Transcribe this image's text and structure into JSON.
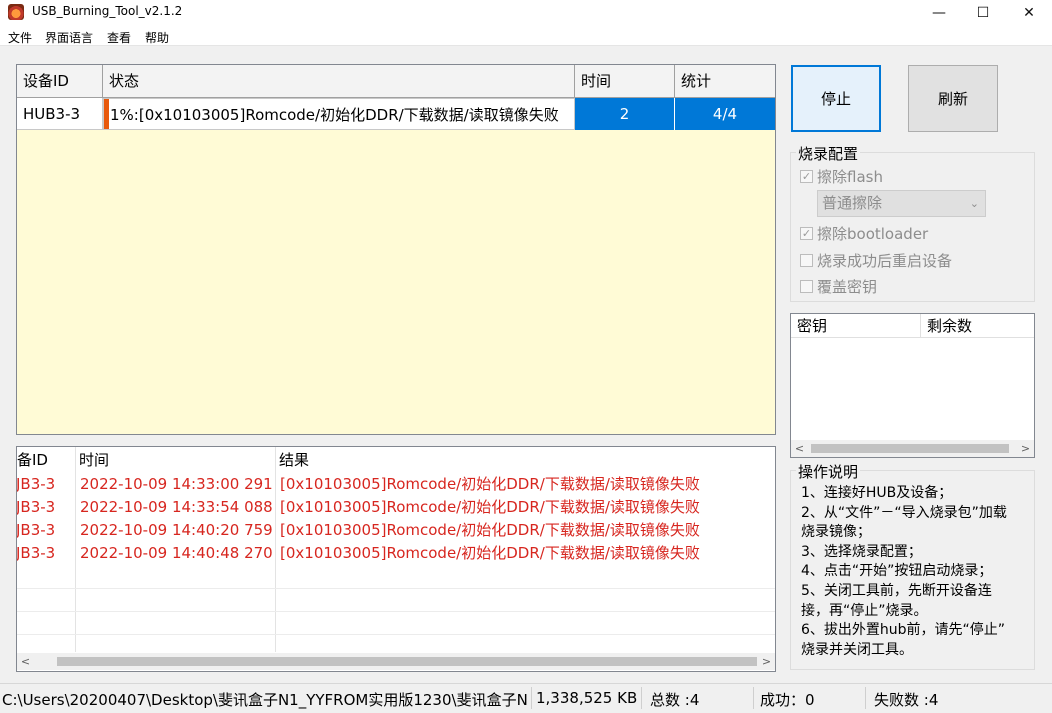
{
  "window": {
    "title": "USB_Burning_Tool_v2.1.2",
    "minimize": "—",
    "maximize": "☐",
    "close": "✕"
  },
  "menu": [
    "文件",
    "界面语言",
    "查看",
    "帮助"
  ],
  "device_grid": {
    "headers": [
      "设备ID",
      "状态",
      "时间",
      "统计"
    ],
    "row": {
      "id": "HUB3-3",
      "status": "1%:[0x10103005]Romcode/初始化DDR/下载数据/读取镜像失败",
      "time": "2",
      "stats": "4/4"
    },
    "status_progress": 0.01
  },
  "log_grid": {
    "headers": [
      "备ID",
      "时间",
      "结果"
    ],
    "rows": [
      {
        "id": "JB3-3",
        "time": "2022-10-09 14:33:00 291",
        "result": "[0x10103005]Romcode/初始化DDR/下载数据/读取镜像失败"
      },
      {
        "id": "JB3-3",
        "time": "2022-10-09 14:33:54 088",
        "result": "[0x10103005]Romcode/初始化DDR/下载数据/读取镜像失败"
      },
      {
        "id": "JB3-3",
        "time": "2022-10-09 14:40:20 759",
        "result": "[0x10103005]Romcode/初始化DDR/下载数据/读取镜像失败"
      },
      {
        "id": "JB3-3",
        "time": "2022-10-09 14:40:48 270",
        "result": "[0x10103005]Romcode/初始化DDR/下载数据/读取镜像失败"
      }
    ]
  },
  "buttons": {
    "stop": "停止",
    "refresh": "刷新"
  },
  "burn_config": {
    "title": "烧录配置",
    "erase_flash": "擦除flash",
    "erase_mode": "普通擦除",
    "erase_bootloader": "擦除bootloader",
    "reboot_after": "烧录成功后重启设备",
    "overwrite_key": "覆盖密钥"
  },
  "key_list": {
    "headers": [
      "密钥",
      "剩余数"
    ]
  },
  "instructions": {
    "title": "操作说明",
    "lines": [
      "1、连接好HUB及设备；",
      "2、从“文件”－“导入烧录包”加载",
      "烧录镜像；",
      "3、选择烧录配置；",
      "4、点击“开始”按钮启动烧录；",
      "5、关闭工具前，先断开设备连",
      "接，再“停止”烧录。",
      "6、拔出外置hub前，请先“停止”",
      "烧录并关闭工具。"
    ]
  },
  "status_bar": {
    "path": "C:\\Users\\20200407\\Desktop\\斐讯盒子N1_YYFROM实用版1230\\斐讯盒子N",
    "size": "1,338,525 KB",
    "total": "总数 :4",
    "success": "成功：0",
    "fail": "失败数 :4"
  },
  "colors": {
    "selected_row": "#0078d7",
    "grid_bg": "#fffbd6",
    "log_text": "#d7261f",
    "progress": "#e8590c"
  }
}
